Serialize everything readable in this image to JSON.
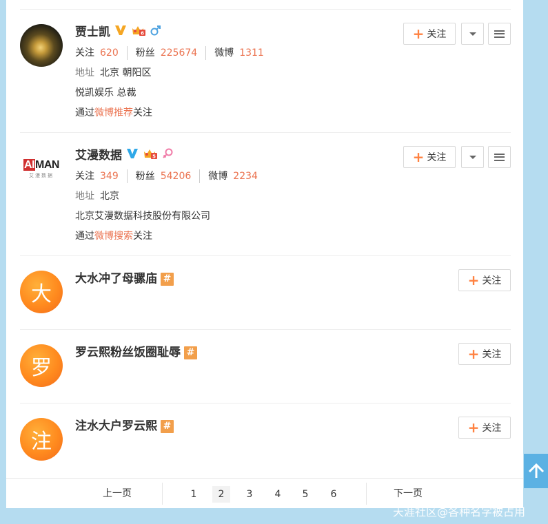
{
  "users": [
    {
      "name": "贾士凯",
      "stats": [
        {
          "label": "关注",
          "value": "620"
        },
        {
          "label": "粉丝",
          "value": "225674"
        },
        {
          "label": "微博",
          "value": "1311"
        }
      ],
      "address_label": "地址",
      "address": "北京 朝阳区",
      "bio": "悦凯娱乐 总裁",
      "via_prefix": "通过",
      "via_link": "微博推荐",
      "via_suffix": "关注",
      "badges": [
        "verified-gold-v-icon",
        "vip-crown-icon",
        "male-icon"
      ]
    },
    {
      "name": "艾漫数据",
      "logo_main_a": "AI",
      "logo_main_b": "MAN",
      "logo_sub": "艾漫数据",
      "stats": [
        {
          "label": "关注",
          "value": "349"
        },
        {
          "label": "粉丝",
          "value": "54206"
        },
        {
          "label": "微博",
          "value": "2234"
        }
      ],
      "address_label": "地址",
      "address": "北京",
      "bio": "北京艾漫数据科技股份有限公司",
      "via_prefix": "通过",
      "via_link": "微博搜索",
      "via_suffix": "关注",
      "badges": [
        "verified-blue-v-icon",
        "vip-crown-icon",
        "female-icon"
      ]
    },
    {
      "name": "大水冲了母骡庙",
      "avatar_char": "大",
      "badge": "topic-hash-icon"
    },
    {
      "name": "罗云熙粉丝饭圈耻辱",
      "avatar_char": "罗",
      "badge": "topic-hash-icon"
    },
    {
      "name": "注水大户罗云熙",
      "avatar_char": "注",
      "badge": "topic-hash-icon"
    }
  ],
  "follow_label": "关注",
  "hash_glyph": "#",
  "pagination": {
    "prev": "上一页",
    "next": "下一页",
    "pages": [
      "1",
      "2",
      "3",
      "4",
      "5",
      "6"
    ],
    "current": "2"
  },
  "watermark": "天涯社区@各种名字被占用",
  "colors": {
    "accent": "#eb7350",
    "plus": "#ff8140",
    "avatar_orange": "#ff8a1e",
    "hash_bg": "#f29f4b",
    "page_bg": "#b5dcf0",
    "to_top_bg": "#5bb1e3"
  }
}
